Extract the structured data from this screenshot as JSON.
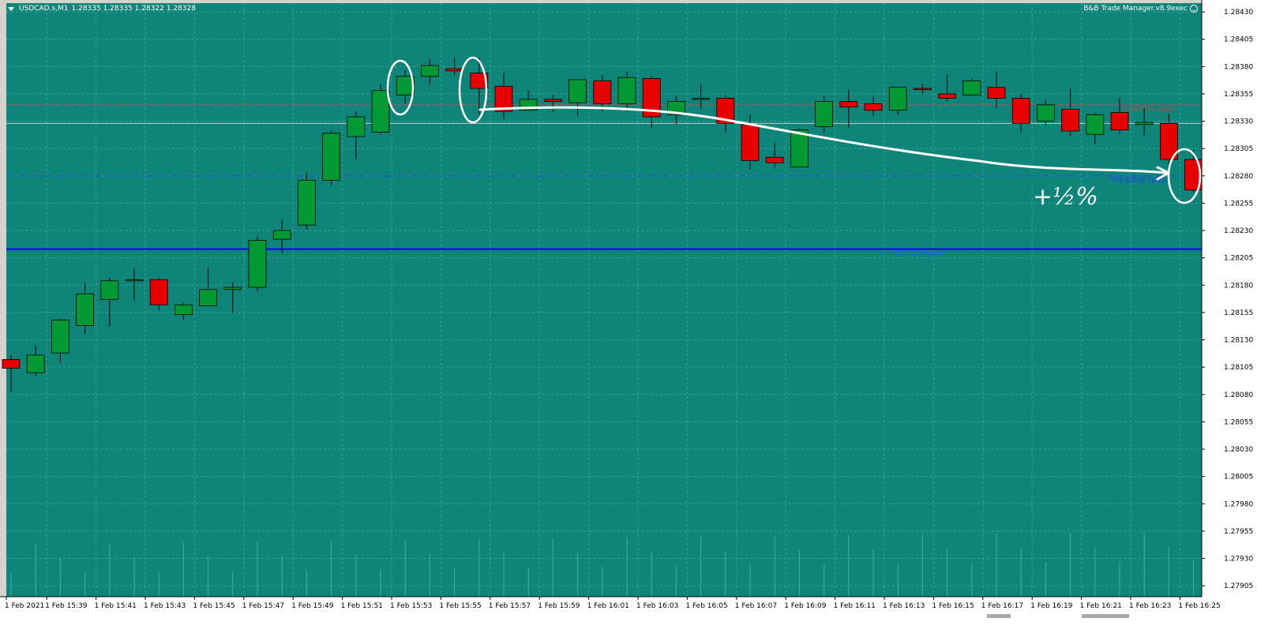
{
  "header": {
    "symbol_label": "USDCAD.s,M1",
    "ohlc": "1.28335 1.28335 1.28322 1.28328",
    "ea_label": "B&B Trade Manager.v8.9exec"
  },
  "annotation": {
    "handwritten": "+½%"
  },
  "colors": {
    "background": "#0f857a",
    "grid": "#5cb3aa",
    "bull": "#009933",
    "bear": "#e60000",
    "wick": "#000000",
    "bid_line": "#c8c8c8",
    "entry_line": "#c85050",
    "tp1_line": "#1e3cff",
    "tp2_line": "#0000ff",
    "volume": "#5ad9c0",
    "annotation": "#ffffff"
  },
  "chart_data": {
    "type": "candlestick",
    "symbol": "USDCAD.s",
    "timeframe": "M1",
    "ylim": [
      1.27895,
      1.28438
    ],
    "grid": true,
    "y_ticks": [
      "1.28430",
      "1.28405",
      "1.28380",
      "1.28355",
      "1.28330",
      "1.28305",
      "1.28280",
      "1.28255",
      "1.28230",
      "1.28205",
      "1.28180",
      "1.28155",
      "1.28130",
      "1.28105",
      "1.28080",
      "1.28055",
      "1.28030",
      "1.28005",
      "1.27980",
      "1.27955",
      "1.27930",
      "1.27905"
    ],
    "x_tick_labels": [
      "1 Feb 2021",
      "1 Feb 15:39",
      "1 Feb 15:41",
      "1 Feb 15:43",
      "1 Feb 15:45",
      "1 Feb 15:47",
      "1 Feb 15:49",
      "1 Feb 15:51",
      "1 Feb 15:53",
      "1 Feb 15:55",
      "1 Feb 15:57",
      "1 Feb 15:59",
      "1 Feb 16:01",
      "1 Feb 16:03",
      "1 Feb 16:05",
      "1 Feb 16:07",
      "1 Feb 16:09",
      "1 Feb 16:11",
      "1 Feb 16:13",
      "1 Feb 16:15",
      "1 Feb 16:17",
      "1 Feb 16:19",
      "1 Feb 16:21",
      "1 Feb 16:23",
      "1 Feb 16:25"
    ],
    "candles": [
      {
        "o": 1.28112,
        "h": 1.28116,
        "l": 1.28082,
        "c": 1.28104
      },
      {
        "o": 1.281,
        "h": 1.28125,
        "l": 1.28097,
        "c": 1.28116
      },
      {
        "o": 1.28118,
        "h": 1.28149,
        "l": 1.28109,
        "c": 1.28148
      },
      {
        "o": 1.28143,
        "h": 1.28182,
        "l": 1.28135,
        "c": 1.28172
      },
      {
        "o": 1.28167,
        "h": 1.28187,
        "l": 1.28142,
        "c": 1.28184
      },
      {
        "o": 1.28185,
        "h": 1.28195,
        "l": 1.28166,
        "c": 1.28185
      },
      {
        "o": 1.28185,
        "h": 1.28187,
        "l": 1.28157,
        "c": 1.28162
      },
      {
        "o": 1.28153,
        "h": 1.28164,
        "l": 1.28148,
        "c": 1.28162
      },
      {
        "o": 1.28161,
        "h": 1.28196,
        "l": 1.28162,
        "c": 1.28176
      },
      {
        "o": 1.28176,
        "h": 1.28183,
        "l": 1.28155,
        "c": 1.28178
      },
      {
        "o": 1.28178,
        "h": 1.28225,
        "l": 1.28174,
        "c": 1.28221
      },
      {
        "o": 1.28222,
        "h": 1.2824,
        "l": 1.28209,
        "c": 1.2823
      },
      {
        "o": 1.28235,
        "h": 1.28283,
        "l": 1.28231,
        "c": 1.28276
      },
      {
        "o": 1.28276,
        "h": 1.28322,
        "l": 1.28271,
        "c": 1.28319
      },
      {
        "o": 1.28316,
        "h": 1.28339,
        "l": 1.28295,
        "c": 1.28334
      },
      {
        "o": 1.2832,
        "h": 1.28364,
        "l": 1.28318,
        "c": 1.28358
      },
      {
        "o": 1.28354,
        "h": 1.28377,
        "l": 1.28346,
        "c": 1.28371
      },
      {
        "o": 1.28371,
        "h": 1.28387,
        "l": 1.28363,
        "c": 1.28381
      },
      {
        "o": 1.28378,
        "h": 1.28388,
        "l": 1.28372,
        "c": 1.28376
      },
      {
        "o": 1.28374,
        "h": 1.28388,
        "l": 1.28336,
        "c": 1.2836
      },
      {
        "o": 1.28362,
        "h": 1.28374,
        "l": 1.28332,
        "c": 1.28339
      },
      {
        "o": 1.2834,
        "h": 1.28358,
        "l": 1.28341,
        "c": 1.2835
      },
      {
        "o": 1.2835,
        "h": 1.28354,
        "l": 1.28338,
        "c": 1.28348
      },
      {
        "o": 1.28347,
        "h": 1.28366,
        "l": 1.28335,
        "c": 1.28368
      },
      {
        "o": 1.28367,
        "h": 1.28372,
        "l": 1.28339,
        "c": 1.28346
      },
      {
        "o": 1.28346,
        "h": 1.28375,
        "l": 1.28339,
        "c": 1.2837
      },
      {
        "o": 1.28369,
        "h": 1.28372,
        "l": 1.28324,
        "c": 1.28334
      },
      {
        "o": 1.28336,
        "h": 1.28353,
        "l": 1.28327,
        "c": 1.28348
      },
      {
        "o": 1.2835,
        "h": 1.28364,
        "l": 1.28341,
        "c": 1.28351
      },
      {
        "o": 1.28351,
        "h": 1.28354,
        "l": 1.2832,
        "c": 1.28328
      },
      {
        "o": 1.28327,
        "h": 1.28336,
        "l": 1.28286,
        "c": 1.28294
      },
      {
        "o": 1.28297,
        "h": 1.2831,
        "l": 1.28288,
        "c": 1.28292
      },
      {
        "o": 1.28288,
        "h": 1.28323,
        "l": 1.28289,
        "c": 1.28322
      },
      {
        "o": 1.28325,
        "h": 1.28353,
        "l": 1.2832,
        "c": 1.28348
      },
      {
        "o": 1.28348,
        "h": 1.28359,
        "l": 1.28324,
        "c": 1.28343
      },
      {
        "o": 1.28346,
        "h": 1.28353,
        "l": 1.28335,
        "c": 1.2834
      },
      {
        "o": 1.2834,
        "h": 1.2836,
        "l": 1.28336,
        "c": 1.28361
      },
      {
        "o": 1.2836,
        "h": 1.28364,
        "l": 1.28355,
        "c": 1.28359
      },
      {
        "o": 1.28355,
        "h": 1.28373,
        "l": 1.28348,
        "c": 1.28351
      },
      {
        "o": 1.28354,
        "h": 1.28369,
        "l": 1.28354,
        "c": 1.28367
      },
      {
        "o": 1.28361,
        "h": 1.28375,
        "l": 1.28342,
        "c": 1.28351
      },
      {
        "o": 1.28351,
        "h": 1.28355,
        "l": 1.2832,
        "c": 1.28328
      },
      {
        "o": 1.2833,
        "h": 1.2835,
        "l": 1.28326,
        "c": 1.28345
      },
      {
        "o": 1.28341,
        "h": 1.2836,
        "l": 1.28316,
        "c": 1.28321
      },
      {
        "o": 1.28318,
        "h": 1.28338,
        "l": 1.28309,
        "c": 1.28336
      },
      {
        "o": 1.28338,
        "h": 1.28351,
        "l": 1.28318,
        "c": 1.28322
      },
      {
        "o": 1.28327,
        "h": 1.28342,
        "l": 1.28317,
        "c": 1.28329
      },
      {
        "o": 1.28328,
        "h": 1.28337,
        "l": 1.28291,
        "c": 1.28295
      },
      {
        "o": 1.28295,
        "h": 1.28304,
        "l": 1.28265,
        "c": 1.28267
      }
    ],
    "levels": [
      {
        "name": "entry",
        "price": 1.28345,
        "style": "dash",
        "label": "0.2871(1.pips)",
        "price_label": "1.28345"
      },
      {
        "name": "bid",
        "price": 1.28328,
        "style": "solid",
        "label": "",
        "price_label": "1.28328"
      },
      {
        "name": "tp1",
        "price": 1.2828,
        "style": "dashdot",
        "label": "TP1 B/E(6.7pips)",
        "price_label": "1.28280"
      },
      {
        "name": "tp2",
        "price": 1.28213,
        "style": "solid",
        "label": "TP2 (13.4pips)",
        "price_label": "1.28213"
      }
    ]
  }
}
